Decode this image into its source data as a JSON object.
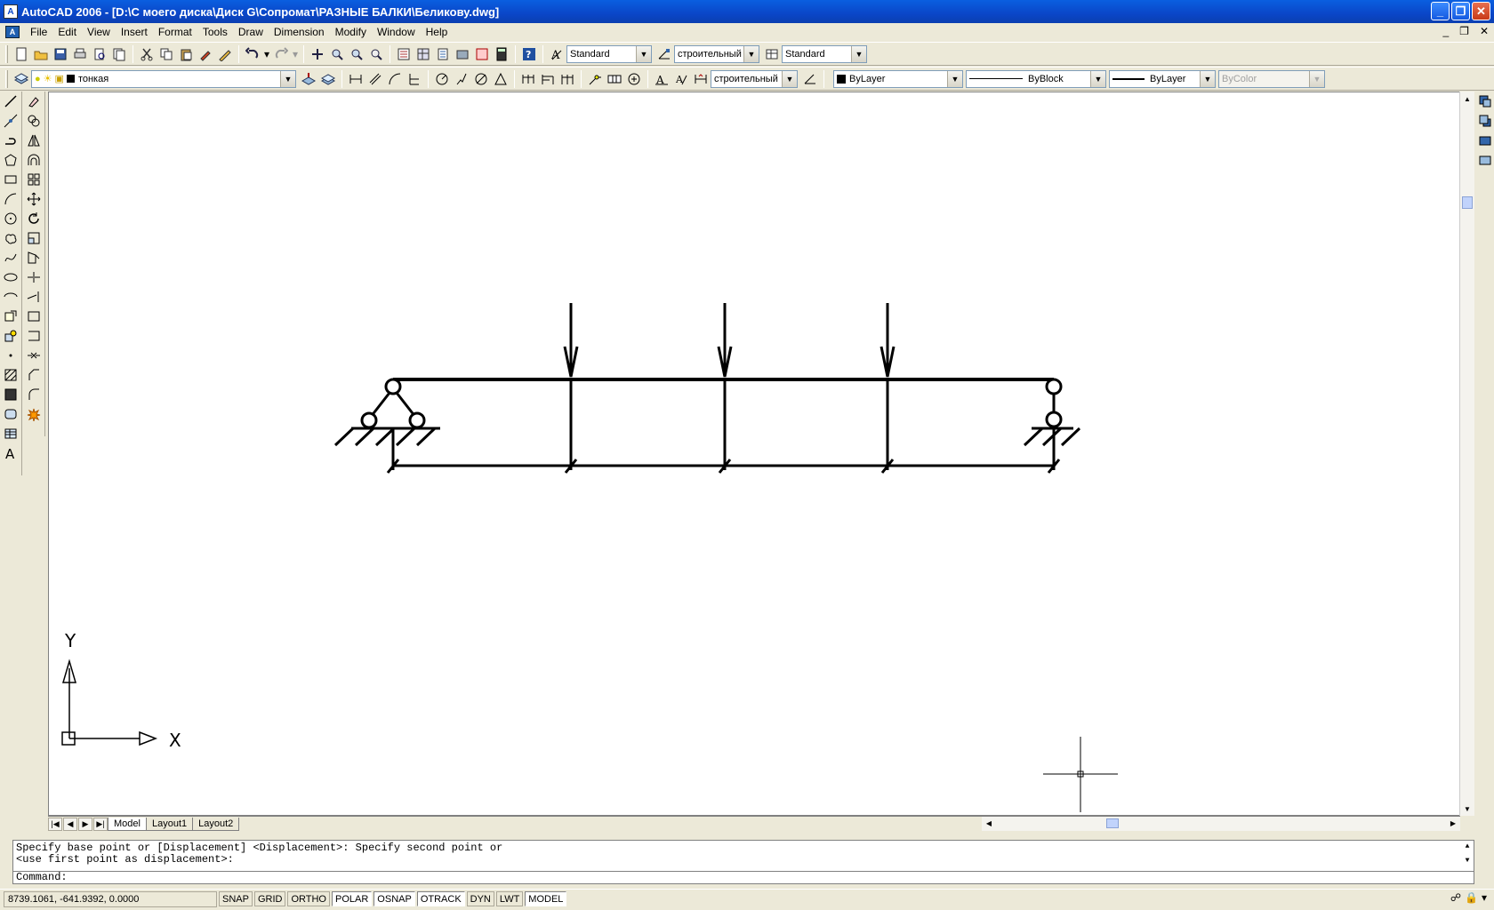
{
  "window": {
    "title": "AutoCAD 2006 - [D:\\С моего диска\\Диск G\\Сопромат\\РАЗНЫЕ БАЛКИ\\Беликову.dwg]",
    "minimize": "_",
    "restore": "❐",
    "close": "✕"
  },
  "menu": {
    "items": [
      "File",
      "Edit",
      "View",
      "Insert",
      "Format",
      "Tools",
      "Draw",
      "Dimension",
      "Modify",
      "Window",
      "Help"
    ]
  },
  "styles_toolbar": {
    "text_style": "Standard",
    "dim_style": "строительный",
    "table_style": "Standard"
  },
  "layers_toolbar": {
    "current_layer": "тонкая"
  },
  "dim_toolbar": {
    "dim_style": "строительный"
  },
  "properties_toolbar": {
    "color": "ByLayer",
    "linetype": "ByBlock",
    "lineweight": "ByLayer",
    "plotstyle": "ByColor"
  },
  "layout_tabs": [
    "Model",
    "Layout1",
    "Layout2"
  ],
  "ucs": {
    "x_label": "X",
    "y_label": "Y"
  },
  "command": {
    "history_line1": "Specify base point or [Displacement] <Displacement>: Specify second point or",
    "history_line2": "<use first point as displacement>:",
    "prompt": "Command:"
  },
  "status": {
    "coordinates": "8739.1061, -641.9392, 0.0000",
    "toggles": [
      "SNAP",
      "GRID",
      "ORTHO",
      "POLAR",
      "OSNAP",
      "OTRACK",
      "DYN",
      "LWT",
      "MODEL"
    ],
    "on_toggles": [
      "POLAR",
      "OSNAP",
      "OTRACK",
      "MODEL"
    ]
  },
  "icons": {
    "app": "autocad-icon",
    "colors": {
      "title": "#0a46c8",
      "canvas": "#ffffff"
    }
  }
}
